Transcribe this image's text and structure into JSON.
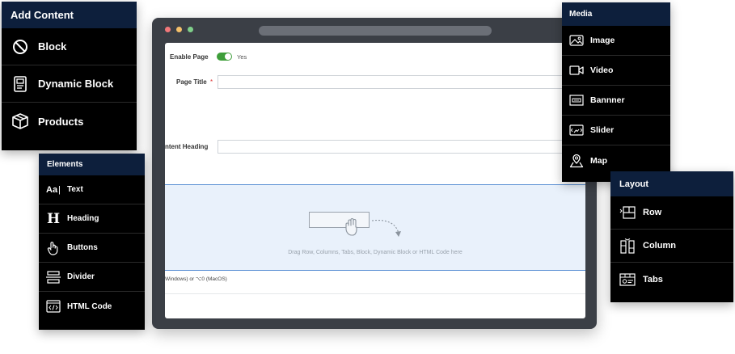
{
  "browser": {
    "form": {
      "enable_page": {
        "label": "Enable Page",
        "value": "Yes",
        "checked": true
      },
      "page_title": {
        "label": "Page Title",
        "required_mark": "*",
        "value": ""
      },
      "content_heading": {
        "label": "ntent Heading",
        "value": ""
      }
    },
    "dropzone": {
      "text": "Drag Row, Columns, Tabs, Block, Dynamic Block or HTML Code here"
    },
    "shortcut_hint": "Windows) or ⌥0 (MacOS)"
  },
  "add_content": {
    "title": "Add Content",
    "items": [
      {
        "label": "Block",
        "icon": "block-icon"
      },
      {
        "label": "Dynamic Block",
        "icon": "dynamic-block-icon"
      },
      {
        "label": "Products",
        "icon": "products-icon"
      }
    ]
  },
  "elements": {
    "title": "Elements",
    "items": [
      {
        "label": "Text",
        "icon": "text-icon",
        "glyph": "Aa"
      },
      {
        "label": "Heading",
        "icon": "heading-icon",
        "glyph": "H"
      },
      {
        "label": "Buttons",
        "icon": "buttons-icon"
      },
      {
        "label": "Divider",
        "icon": "divider-icon"
      },
      {
        "label": "HTML Code",
        "icon": "html-code-icon"
      }
    ]
  },
  "media": {
    "title": "Media",
    "items": [
      {
        "label": "Image",
        "icon": "image-icon"
      },
      {
        "label": "Video",
        "icon": "video-icon"
      },
      {
        "label": "Bannner",
        "icon": "banner-icon"
      },
      {
        "label": "Slider",
        "icon": "slider-icon"
      },
      {
        "label": "Map",
        "icon": "map-icon"
      }
    ]
  },
  "layout": {
    "title": "Layout",
    "items": [
      {
        "label": "Row",
        "icon": "row-icon"
      },
      {
        "label": "Column",
        "icon": "column-icon"
      },
      {
        "label": "Tabs",
        "icon": "tabs-icon"
      }
    ]
  },
  "colors": {
    "panel_header": "#0d1f3c",
    "panel_body": "#000000",
    "toggle_on": "#3e9e3a",
    "dropzone_bg": "#e9f1fb",
    "dropzone_border": "#5a8fd4",
    "required": "#dd3333"
  }
}
